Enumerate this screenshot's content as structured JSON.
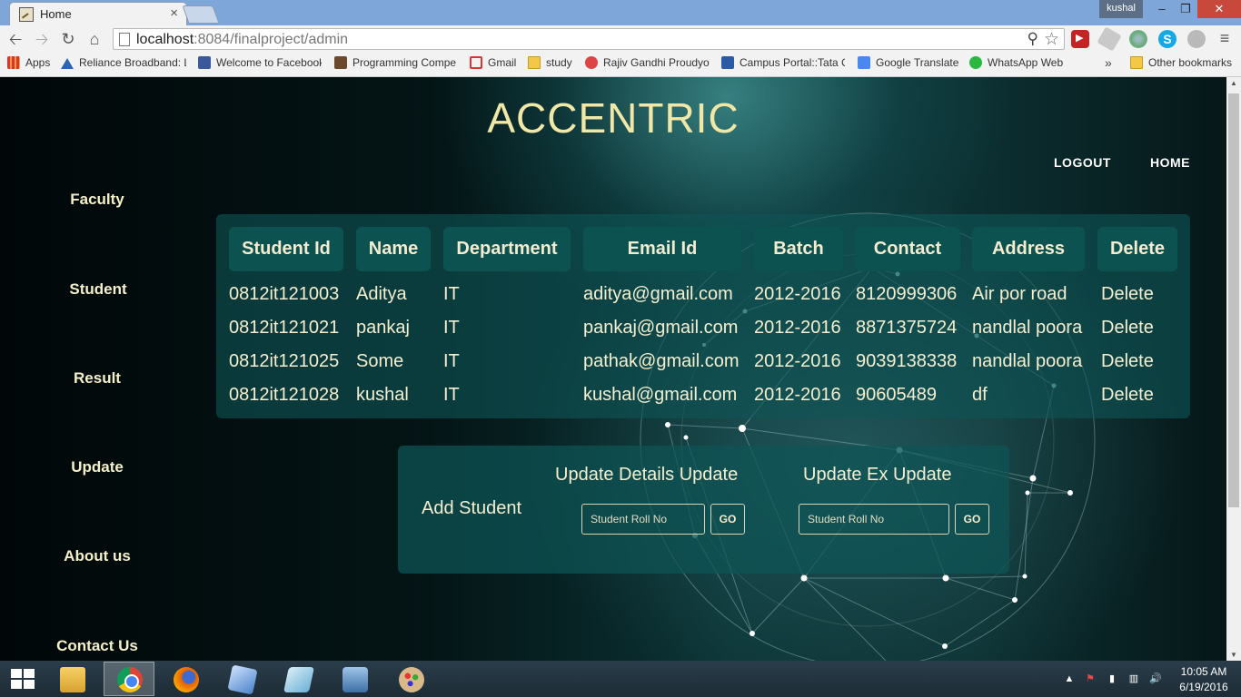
{
  "browser": {
    "tab_title": "Home",
    "tab_close": "×",
    "profile_name": "kushal",
    "url_host": "localhost",
    "url_path": ":8084/finalproject/admin",
    "bookmarks": [
      {
        "label": "Apps"
      },
      {
        "label": "Reliance Broadband: L"
      },
      {
        "label": "Welcome to Facebook"
      },
      {
        "label": "Programming Compe"
      },
      {
        "label": "Gmail"
      },
      {
        "label": "study"
      },
      {
        "label": "Rajiv Gandhi Proudyo"
      },
      {
        "label": "Campus Portal::Tata C"
      },
      {
        "label": "Google Translate"
      },
      {
        "label": "WhatsApp Web"
      }
    ],
    "bookmarks_more": "»",
    "other_bookmarks": "Other bookmarks",
    "extension_skype_letter": "S"
  },
  "page": {
    "site_title": "ACCENTRIC",
    "nav": {
      "logout": "LOGOUT",
      "home": "HOME"
    },
    "sidebar": [
      "Faculty",
      "Student",
      "Result",
      "Update",
      "About us",
      "Contact Us"
    ],
    "table": {
      "headers": [
        "Student Id",
        "Name",
        "Department",
        "Email Id",
        "Batch",
        "Contact",
        "Address",
        "Delete"
      ],
      "rows": [
        [
          "0812it121003",
          "Aditya",
          "IT",
          "aditya@gmail.com",
          "2012-2016",
          "8120999306",
          "Air por road",
          "Delete"
        ],
        [
          "0812it121021",
          "pankaj",
          "IT",
          "pankaj@gmail.com",
          "2012-2016",
          "8871375724",
          "nandlal poora",
          "Delete"
        ],
        [
          "0812it121025",
          "Some",
          "IT",
          "pathak@gmail.com",
          "2012-2016",
          "9039138338",
          "nandlal poora",
          "Delete"
        ],
        [
          "0812it121028",
          "kushal",
          "IT",
          "kushal@gmail.com",
          "2012-2016",
          "90605489",
          "df",
          "Delete"
        ]
      ]
    },
    "form": {
      "add_student": "Add Student",
      "update_details_title": "Update Details Update",
      "update_ex_title": "Update Ex Update",
      "roll_placeholder": "Student Roll No",
      "go_label": "GO"
    }
  },
  "taskbar": {
    "time": "10:05 AM",
    "date": "6/19/2016"
  },
  "colors": {
    "title": "#f1e7a6",
    "panel": "#0e5456",
    "header_cell": "#0c5250",
    "text": "#f6efcf"
  },
  "icons": [
    "back-icon",
    "forward-icon",
    "reload-icon",
    "home-icon",
    "search-icon",
    "star-icon",
    "menu-icon",
    "windows-start-icon",
    "file-explorer-icon",
    "chrome-icon",
    "firefox-icon",
    "virtualbox-icon",
    "notes-icon",
    "remote-desktop-icon",
    "paint-icon"
  ]
}
